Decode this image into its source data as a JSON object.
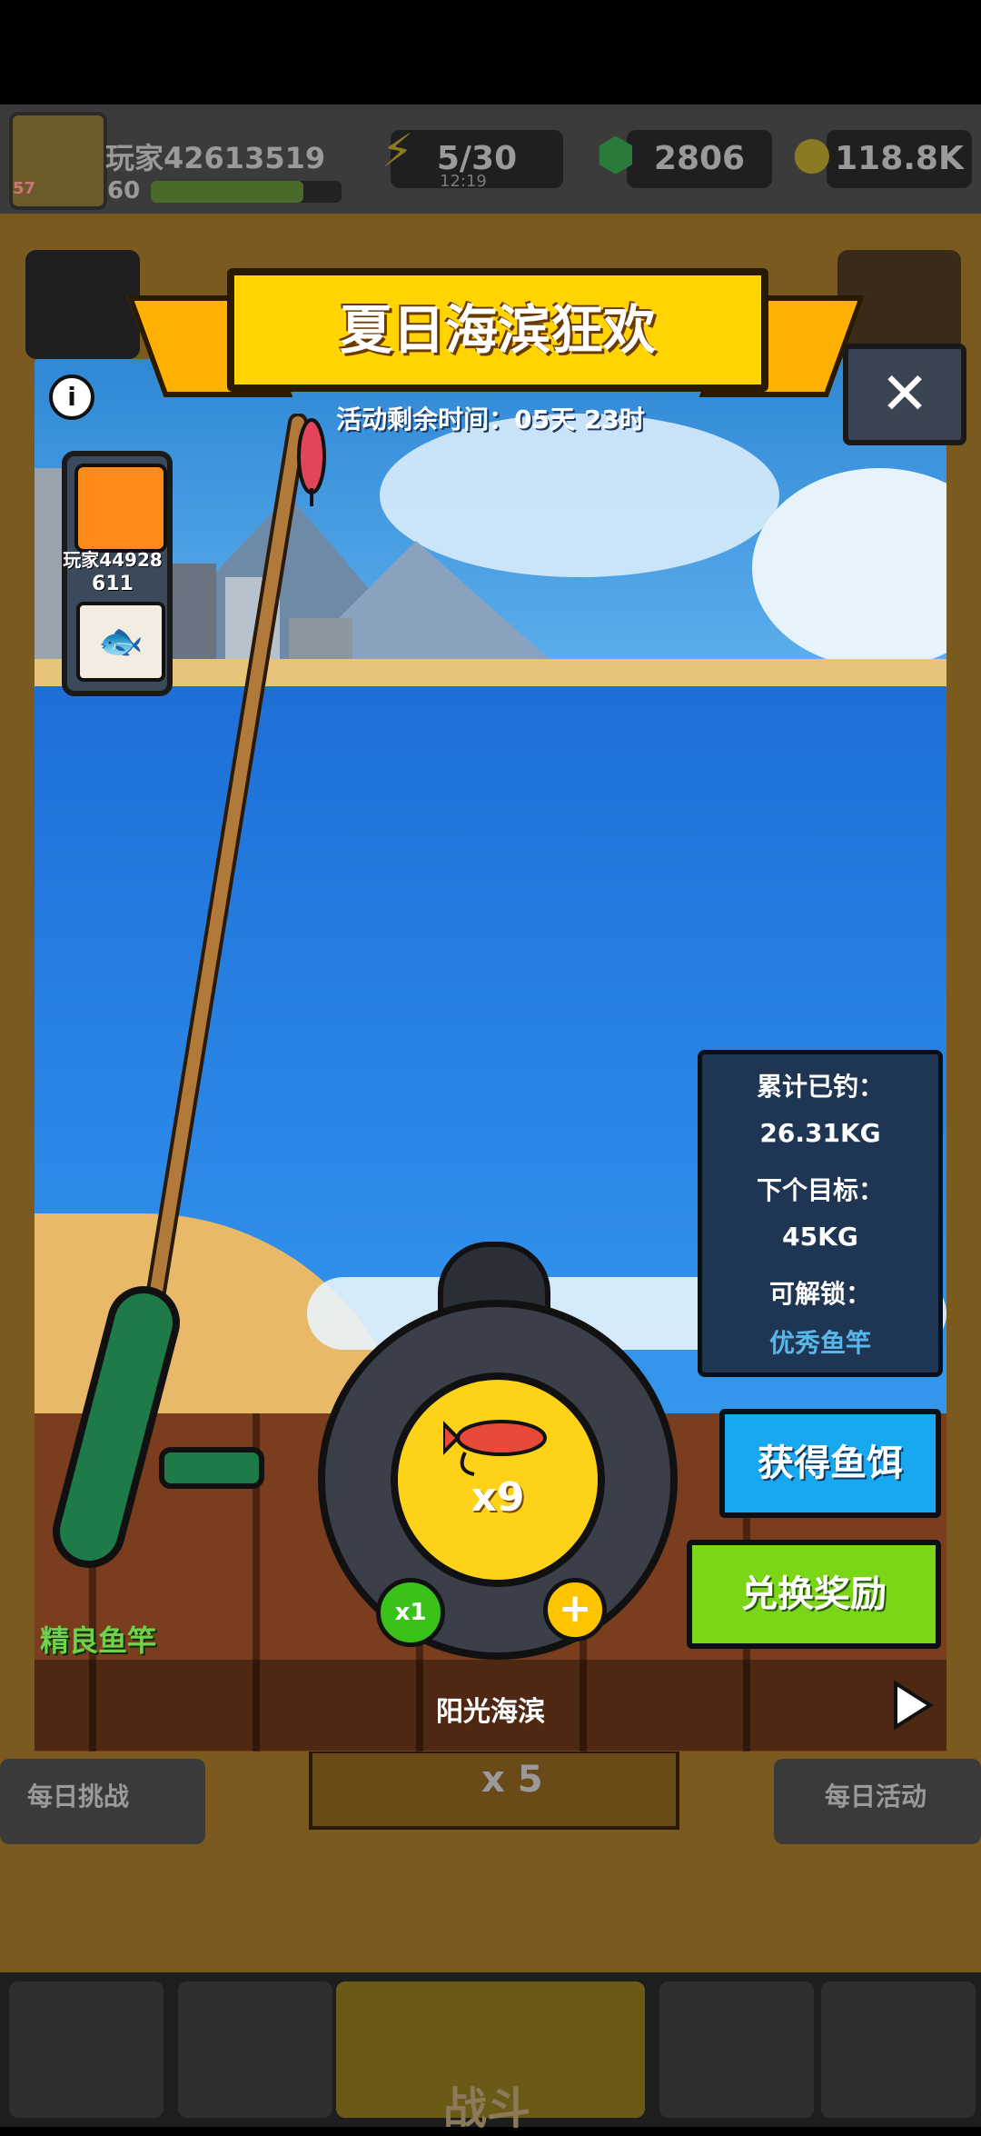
{
  "hud": {
    "player_name": "玩家42613519",
    "player_level": "60",
    "avatar_badge": "57",
    "energy": "5/30",
    "energy_timer": "12:19",
    "gems": "2806",
    "coins": "118.8K"
  },
  "background": {
    "left_label": "每日挑战",
    "right_label": "每日活动",
    "energy_cost": "x 5",
    "battle_label": "战斗"
  },
  "event": {
    "title": "夏日海滨狂欢",
    "timer": "活动剩余时间：05天 23时",
    "close_icon": "close-icon",
    "info_icon": "info-icon"
  },
  "player_card": {
    "name": "玩家44928",
    "score": "611"
  },
  "stats": {
    "caught_label": "累计已钓：",
    "caught_value": "26.31KG",
    "target_label": "下个目标：",
    "target_value": "45KG",
    "unlock_label": "可解锁：",
    "unlock_value": "优秀鱼竿"
  },
  "buttons": {
    "get_bait": "获得鱼饵",
    "redeem": "兑换奖励"
  },
  "reel": {
    "bait_count": "x9",
    "multiplier": "x1",
    "plus": "+"
  },
  "rod_name": "精良鱼竿",
  "location": "阳光海滨",
  "colors": {
    "title_yellow": "#ffd400",
    "stats_bg": "#1e3554",
    "get_bait_blue": "#18a8f0",
    "redeem_green": "#7ad616",
    "unlock_teal": "#58b6e8",
    "rod_label_green": "#6fd24a"
  }
}
